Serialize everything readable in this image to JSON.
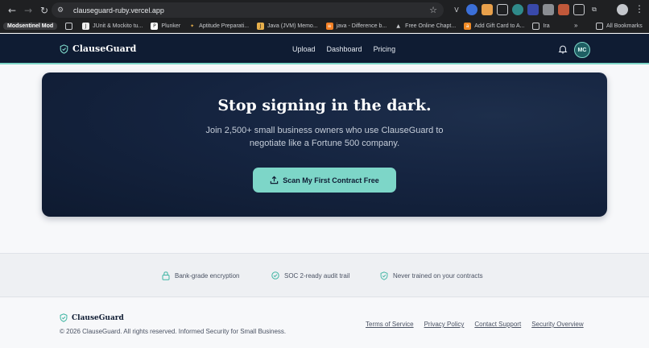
{
  "browser": {
    "url": "clauseguard-ruby.vercel.app",
    "bookmarks": [
      {
        "label": "Modsentinel Mod",
        "icon": "modsentinel-icon"
      },
      {
        "label": "JUnit & Mockito tu...",
        "icon": "junit-icon"
      },
      {
        "label": "Plunker",
        "icon": "plunker-icon"
      },
      {
        "label": "Aptitude Preparati...",
        "icon": "aptitude-icon"
      },
      {
        "label": "Java (JVM) Memo...",
        "icon": "java-memory-icon"
      },
      {
        "label": "java - Difference b...",
        "icon": "stackoverflow-icon"
      },
      {
        "label": "Free Online Chapt...",
        "icon": "book-icon"
      },
      {
        "label": "Add Gift Card to A...",
        "icon": "amazon-icon"
      },
      {
        "label": "Ira",
        "icon": "folder-icon"
      }
    ],
    "all_bookmarks_label": "All Bookmarks",
    "more_label": "»"
  },
  "header": {
    "brand": "ClauseGuard",
    "nav": [
      "Upload",
      "Dashboard",
      "Pricing"
    ],
    "avatar_initials": "MC"
  },
  "cta": {
    "title": "Stop signing in the dark.",
    "subtitle": "Join 2,500+ small business owners who use ClauseGuard to negotiate like a Fortune 500 company.",
    "button_label": "Scan My First Contract Free"
  },
  "trust": [
    {
      "label": "Bank-grade encryption",
      "icon": "lock-icon"
    },
    {
      "label": "SOC 2-ready audit trail",
      "icon": "check-circle-icon"
    },
    {
      "label": "Never trained on your contracts",
      "icon": "shield-check-icon"
    }
  ],
  "footer": {
    "brand": "ClauseGuard",
    "copyright": "© 2026 ClauseGuard. All rights reserved. Informed Security for Small Business.",
    "links": [
      "Terms of Service",
      "Privacy Policy",
      "Contact Support",
      "Security Overview"
    ]
  },
  "colors": {
    "navy": "#0f1c33",
    "accent": "#7dd6c8"
  }
}
